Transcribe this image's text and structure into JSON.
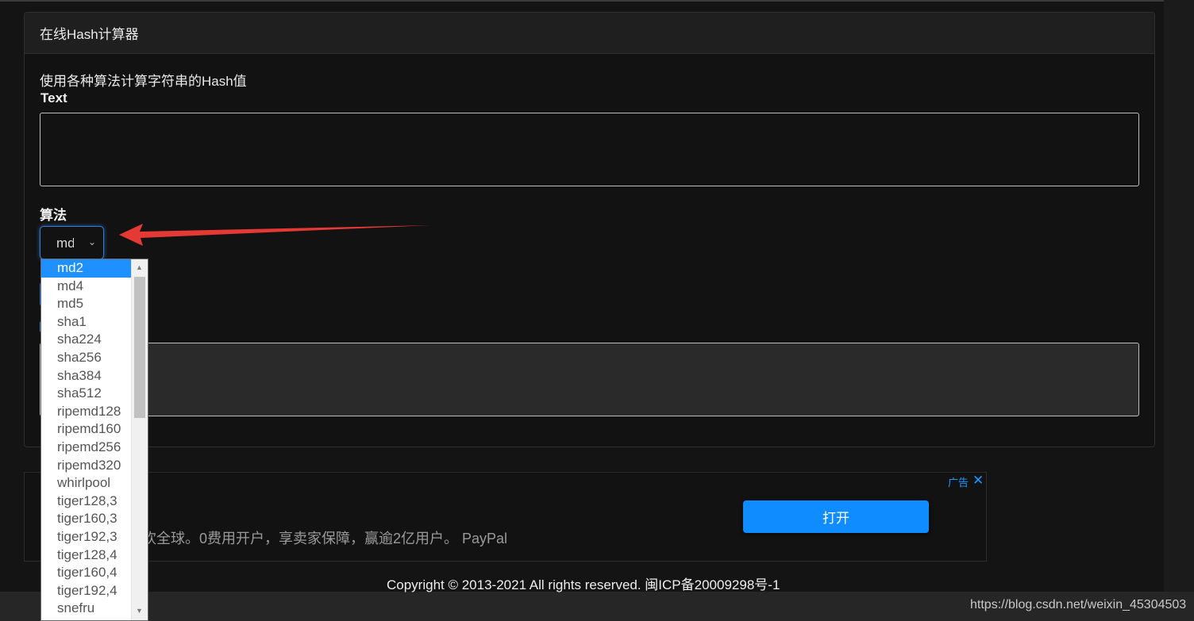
{
  "panel": {
    "title": "在线Hash计算器",
    "description": "使用各种算法计算字符串的Hash值",
    "text_label": "Text",
    "text_value": "",
    "algo_label": "算法",
    "algo_selected": "md2",
    "output_value": ""
  },
  "dropdown": {
    "options": [
      "md2",
      "md4",
      "md5",
      "sha1",
      "sha224",
      "sha256",
      "sha384",
      "sha512",
      "ripemd128",
      "ripemd160",
      "ripemd256",
      "ripemd320",
      "whirlpool",
      "tiger128,3",
      "tiger160,3",
      "tiger192,3",
      "tiger128,4",
      "tiger160,4",
      "tiger192,4",
      "snefru"
    ],
    "selected_index": 0
  },
  "ad": {
    "text": "欢全球。0费用开户，享卖家保障，赢逾2亿用户。 PayPal",
    "button_label": "打开",
    "tag": "广告",
    "close_glyph": "✕"
  },
  "footer": {
    "copyright": "Copyright © 2013-2021 All rights reserved. 闽ICP备20009298号-1",
    "watermark": "https://blog.csdn.net/weixin_45304503"
  },
  "colors": {
    "accent": "#1e90ff",
    "arrow": "#e53935",
    "ad_button": "#0f8cff"
  }
}
